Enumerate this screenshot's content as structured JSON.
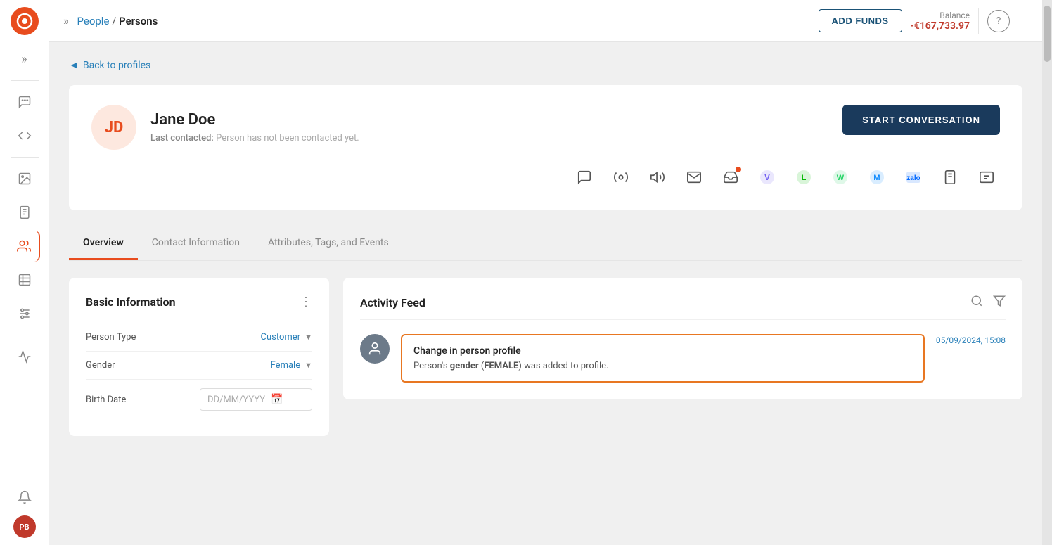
{
  "app": {
    "logo_initials": "⊙",
    "breadcrumb_people": "People",
    "breadcrumb_separator": " / ",
    "breadcrumb_persons": "Persons",
    "add_funds_label": "ADD FUNDS",
    "balance_label": "Balance",
    "balance_value": "-€167,733.97",
    "help_icon": "?"
  },
  "sidebar": {
    "items": [
      {
        "id": "chat",
        "icon": "💬",
        "active": false
      },
      {
        "id": "code",
        "icon": "⌨",
        "active": false
      },
      {
        "id": "gallery",
        "icon": "🖼",
        "active": false
      },
      {
        "id": "forms",
        "icon": "📋",
        "active": false
      },
      {
        "id": "people",
        "icon": "👥",
        "active": true
      },
      {
        "id": "table",
        "icon": "📊",
        "active": false
      },
      {
        "id": "grid",
        "icon": "⚙",
        "active": false
      },
      {
        "id": "analytics",
        "icon": "📈",
        "active": false
      }
    ],
    "bottom_avatar": "PB"
  },
  "back_link": "Back to profiles",
  "profile": {
    "initials": "JD",
    "name": "Jane Doe",
    "last_contacted_label": "Last contacted:",
    "last_contacted_value": "Person has not been contacted yet.",
    "start_conversation_label": "START CONVERSATION"
  },
  "channels": [
    {
      "id": "sms",
      "icon": "💬",
      "label": "sms-icon"
    },
    {
      "id": "chatbot",
      "icon": "🤖",
      "label": "chatbot-icon"
    },
    {
      "id": "voice",
      "icon": "📣",
      "label": "voice-icon"
    },
    {
      "id": "email",
      "icon": "✉",
      "label": "email-icon"
    },
    {
      "id": "inbox",
      "icon": "📥",
      "label": "inbox-icon"
    },
    {
      "id": "viber",
      "icon": "📱",
      "label": "viber-icon"
    },
    {
      "id": "line",
      "icon": "💚",
      "label": "line-icon"
    },
    {
      "id": "whatsapp",
      "icon": "📲",
      "label": "whatsapp-icon"
    },
    {
      "id": "messenger",
      "icon": "💌",
      "label": "messenger-icon"
    },
    {
      "id": "zalo",
      "icon": "🔵",
      "label": "zalo-icon"
    },
    {
      "id": "sms2",
      "icon": "📟",
      "label": "sms2-icon"
    },
    {
      "id": "push",
      "icon": "🔔",
      "label": "push-icon"
    }
  ],
  "tabs": [
    {
      "id": "overview",
      "label": "Overview",
      "active": true
    },
    {
      "id": "contact-info",
      "label": "Contact Information",
      "active": false
    },
    {
      "id": "attributes",
      "label": "Attributes, Tags, and Events",
      "active": false
    }
  ],
  "basic_info": {
    "title": "Basic Information",
    "menu_icon": "⋮",
    "fields": [
      {
        "id": "person-type",
        "label": "Person Type",
        "value": "Customer",
        "type": "dropdown"
      },
      {
        "id": "gender",
        "label": "Gender",
        "value": "Female",
        "type": "dropdown"
      },
      {
        "id": "birth-date",
        "label": "Birth Date",
        "value": "",
        "placeholder": "DD/MM/YYYY",
        "type": "date"
      }
    ]
  },
  "activity_feed": {
    "title": "Activity Feed",
    "search_icon": "search",
    "filter_icon": "filter",
    "item": {
      "avatar_icon": "👤",
      "title": "Change in person profile",
      "text_before": "Person's ",
      "text_bold1": "gender",
      "text_paren": " (",
      "text_bold2": "FEMALE",
      "text_after": ") was added to profile.",
      "timestamp": "05/09/2024, 15:08"
    }
  }
}
